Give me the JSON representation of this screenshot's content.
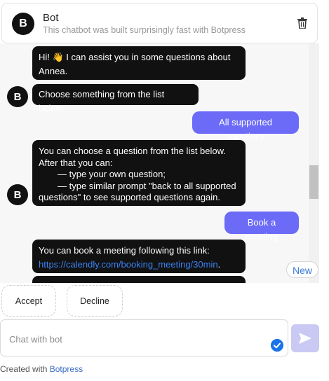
{
  "header": {
    "avatar_letter": "B",
    "bot_name": "Bot",
    "description": "This chatbot was built surprisingly fast with Botpress",
    "delete_icon": "trash-icon"
  },
  "conversation": {
    "messages": [
      {
        "from": "bot",
        "text": "Hi! 👋 I can assist you in some questions about Annea."
      },
      {
        "from": "bot",
        "text": "Choose something from the list below:"
      },
      {
        "from": "user",
        "text": "All supported questions"
      },
      {
        "from": "bot",
        "line1": "You can choose a question from the list below.",
        "line2": "After that you can:",
        "line3": "— type your own question;",
        "line4": "— type similar prompt \"back to all supported",
        "line5": "questions\" to see supported questions again."
      },
      {
        "from": "user",
        "text": "Book a meeting"
      },
      {
        "from": "bot",
        "text": "You can book a meeting following this link:",
        "link": "https://calendly.com/booking_meeting/30min",
        "suffix": "."
      }
    ],
    "new_label": "New"
  },
  "quick_replies": [
    {
      "label": "Accept"
    },
    {
      "label": "Decline"
    }
  ],
  "composer": {
    "placeholder": "Chat with bot",
    "send_icon": "send-icon",
    "status_icon": "check-icon"
  },
  "footer": {
    "prefix": "Created with",
    "brand": "Botpress"
  },
  "colors": {
    "bot_bubble": "#111111",
    "user_bubble": "#6b6bf7",
    "link": "#3b82f6",
    "send_button": "#c9c9f4"
  }
}
